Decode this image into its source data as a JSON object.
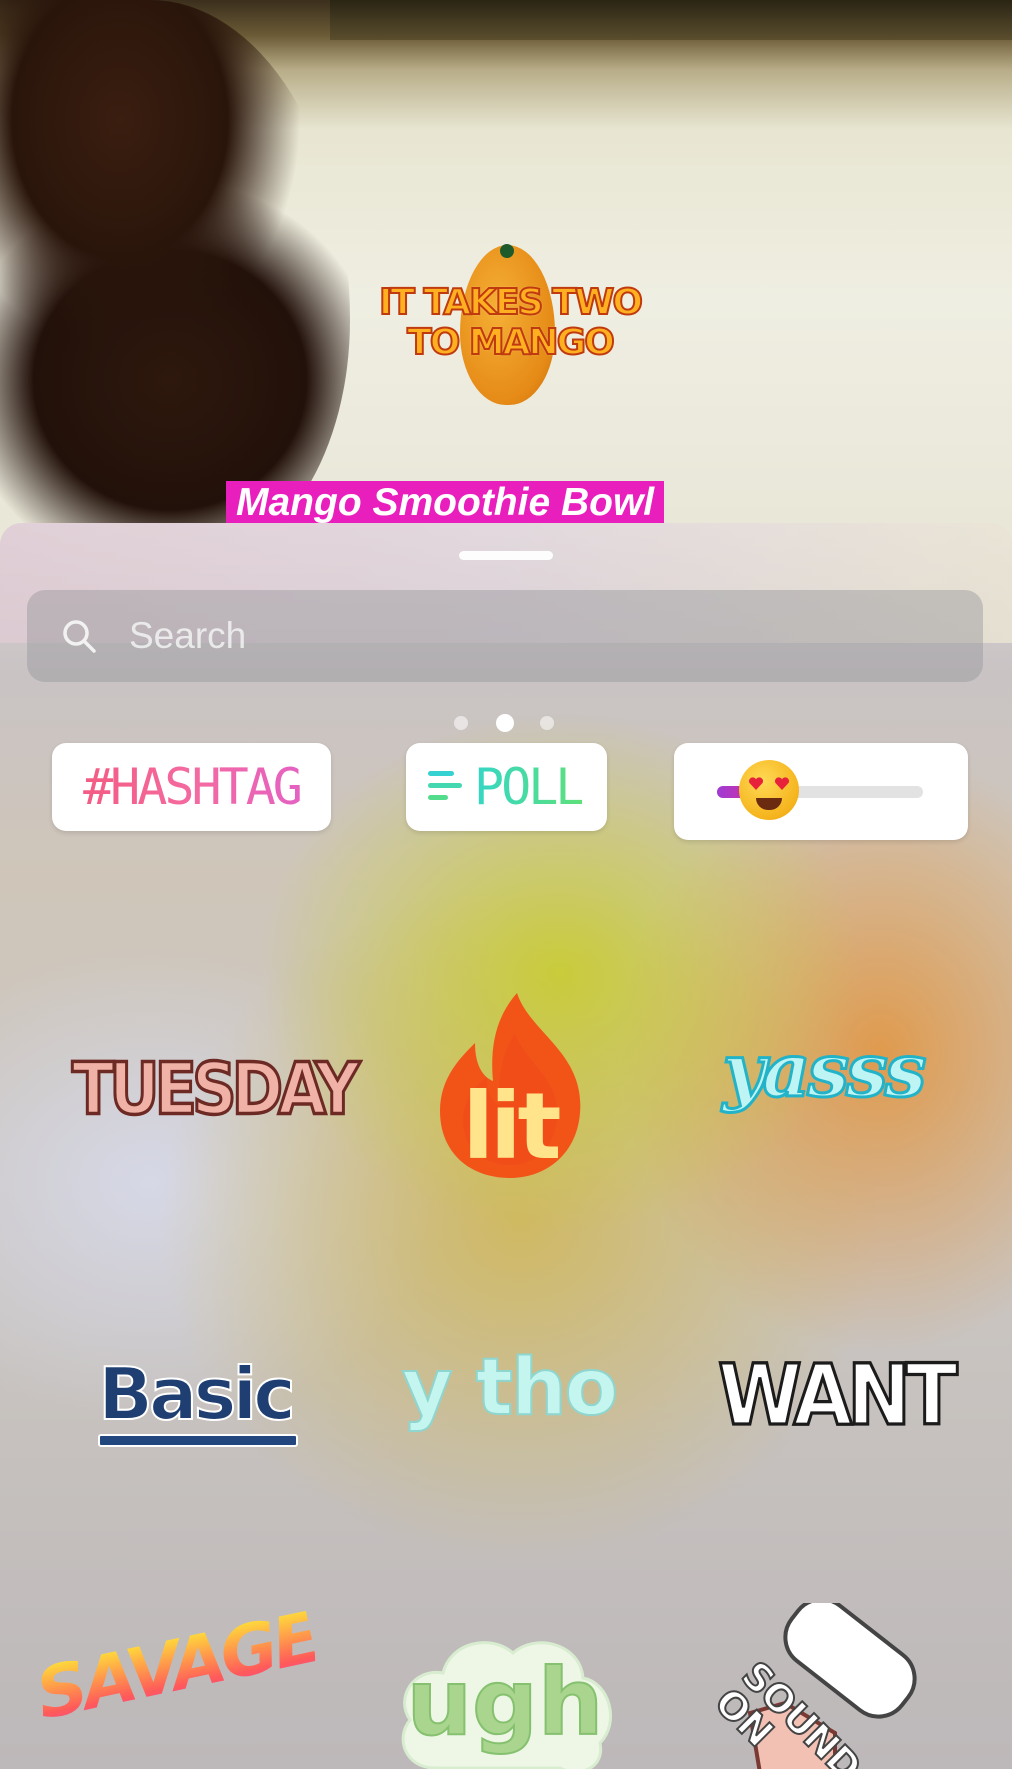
{
  "photo": {
    "sticker_text_line1": "IT TAKES TWO",
    "sticker_text_line2": "TO MANGO",
    "caption": "Mango Smoothie Bowl",
    "caption_color": "#e81ebd"
  },
  "sheet": {
    "search": {
      "placeholder": "Search",
      "icon": "search-icon"
    },
    "page_indicator": {
      "total": 3,
      "current": 2
    },
    "interactive_stickers": {
      "hashtag_label": "#HASHTAG",
      "poll_label": "POLL",
      "poll_icon": "poll-bars-icon",
      "slider": {
        "emoji": "heart-eyes-emoji",
        "value": 0.25
      }
    },
    "stickers": [
      {
        "label": "TUESDAY"
      },
      {
        "label": "lit",
        "icon": "flame-icon"
      },
      {
        "label": "yasss"
      },
      {
        "label": "Basic"
      },
      {
        "label": "y tho"
      },
      {
        "label": "WANT"
      },
      {
        "label": "SAVAGE"
      },
      {
        "label": "ugh"
      },
      {
        "label": "SOUND ON",
        "icon": "speaker-icon"
      }
    ]
  }
}
